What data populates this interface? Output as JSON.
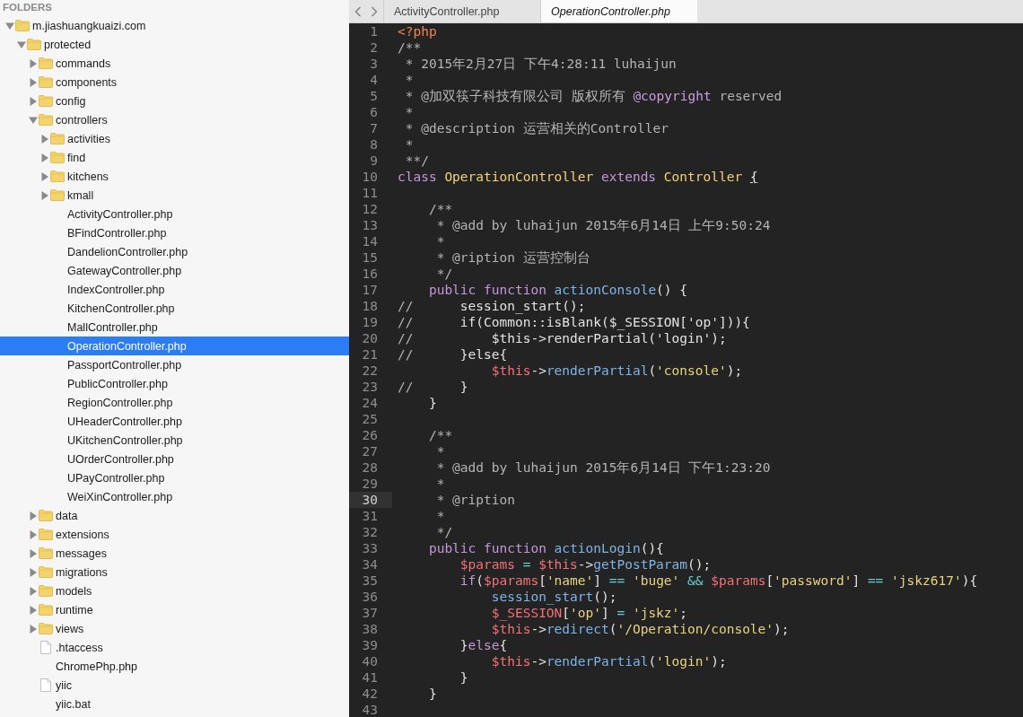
{
  "sidebar": {
    "header": "FOLDERS",
    "tree": [
      {
        "label": "m.jiashuangkuaizi.com",
        "kind": "folder",
        "expanded": true,
        "selected": false,
        "children": [
          {
            "label": "protected",
            "kind": "folder",
            "expanded": true,
            "selected": false,
            "children": [
              {
                "label": "commands",
                "kind": "folder",
                "expanded": false,
                "selected": false
              },
              {
                "label": "components",
                "kind": "folder",
                "expanded": false,
                "selected": false
              },
              {
                "label": "config",
                "kind": "folder",
                "expanded": false,
                "selected": false
              },
              {
                "label": "controllers",
                "kind": "folder",
                "expanded": true,
                "selected": false,
                "children": [
                  {
                    "label": "activities",
                    "kind": "folder",
                    "expanded": false,
                    "selected": false
                  },
                  {
                    "label": "find",
                    "kind": "folder",
                    "expanded": false,
                    "selected": false
                  },
                  {
                    "label": "kitchens",
                    "kind": "folder",
                    "expanded": false,
                    "selected": false
                  },
                  {
                    "label": "kmall",
                    "kind": "folder",
                    "expanded": false,
                    "selected": false
                  },
                  {
                    "label": "ActivityController.php",
                    "kind": "file",
                    "selected": false
                  },
                  {
                    "label": "BFindController.php",
                    "kind": "file",
                    "selected": false
                  },
                  {
                    "label": "DandelionController.php",
                    "kind": "file",
                    "selected": false
                  },
                  {
                    "label": "GatewayController.php",
                    "kind": "file",
                    "selected": false
                  },
                  {
                    "label": "IndexController.php",
                    "kind": "file",
                    "selected": false
                  },
                  {
                    "label": "KitchenController.php",
                    "kind": "file",
                    "selected": false
                  },
                  {
                    "label": "MallController.php",
                    "kind": "file",
                    "selected": false
                  },
                  {
                    "label": "OperationController.php",
                    "kind": "file",
                    "selected": true
                  },
                  {
                    "label": "PassportController.php",
                    "kind": "file",
                    "selected": false
                  },
                  {
                    "label": "PublicController.php",
                    "kind": "file",
                    "selected": false
                  },
                  {
                    "label": "RegionController.php",
                    "kind": "file",
                    "selected": false
                  },
                  {
                    "label": "UHeaderController.php",
                    "kind": "file",
                    "selected": false
                  },
                  {
                    "label": "UKitchenController.php",
                    "kind": "file",
                    "selected": false
                  },
                  {
                    "label": "UOrderController.php",
                    "kind": "file",
                    "selected": false
                  },
                  {
                    "label": "UPayController.php",
                    "kind": "file",
                    "selected": false
                  },
                  {
                    "label": "WeiXinController.php",
                    "kind": "file",
                    "selected": false
                  }
                ]
              },
              {
                "label": "data",
                "kind": "folder",
                "expanded": false,
                "selected": false
              },
              {
                "label": "extensions",
                "kind": "folder",
                "expanded": false,
                "selected": false
              },
              {
                "label": "messages",
                "kind": "folder",
                "expanded": false,
                "selected": false
              },
              {
                "label": "migrations",
                "kind": "folder",
                "expanded": false,
                "selected": false
              },
              {
                "label": "models",
                "kind": "folder",
                "expanded": false,
                "selected": false
              },
              {
                "label": "runtime",
                "kind": "folder",
                "expanded": false,
                "selected": false
              },
              {
                "label": "views",
                "kind": "folder",
                "expanded": false,
                "selected": false
              },
              {
                "label": ".htaccess",
                "kind": "page",
                "selected": false
              },
              {
                "label": "ChromePhp.php",
                "kind": "file",
                "selected": false
              },
              {
                "label": "yiic",
                "kind": "page",
                "selected": false
              },
              {
                "label": "yiic.bat",
                "kind": "file",
                "selected": false
              }
            ]
          }
        ]
      }
    ]
  },
  "tabs": [
    {
      "label": "ActivityController.php",
      "selected": false
    },
    {
      "label": "OperationController.php",
      "selected": true
    }
  ],
  "editor": {
    "lines": [
      {
        "number": "1",
        "current": false,
        "tokens": [
          {
            "text": "<?php",
            "kind": "tag"
          }
        ]
      },
      {
        "number": "2",
        "current": false,
        "tokens": [
          {
            "text": "/**",
            "kind": "comment"
          }
        ]
      },
      {
        "number": "3",
        "current": false,
        "tokens": [
          {
            "text": " * 2015年2月27日 下午4:28:11 luhaijun",
            "kind": "comment"
          }
        ]
      },
      {
        "number": "4",
        "current": false,
        "tokens": [
          {
            "text": " *",
            "kind": "comment"
          }
        ]
      },
      {
        "number": "5",
        "current": false,
        "tokens": [
          {
            "text": " * @加双筷子科技有限公司 版权所有 ",
            "kind": "comment"
          },
          {
            "text": "@copyright",
            "kind": "doctag"
          },
          {
            "text": " reserved",
            "kind": "comment"
          }
        ]
      },
      {
        "number": "6",
        "current": false,
        "tokens": [
          {
            "text": " *",
            "kind": "comment"
          }
        ]
      },
      {
        "number": "7",
        "current": false,
        "tokens": [
          {
            "text": " * @description 运营相关的Controller",
            "kind": "comment"
          }
        ]
      },
      {
        "number": "8",
        "current": false,
        "tokens": [
          {
            "text": " *",
            "kind": "comment"
          }
        ]
      },
      {
        "number": "9",
        "current": false,
        "tokens": [
          {
            "text": " **/",
            "kind": "comment"
          }
        ]
      },
      {
        "number": "10",
        "current": false,
        "tokens": [
          {
            "text": "class",
            "kind": "keyword"
          },
          {
            "text": " OperationController",
            "kind": "class"
          },
          {
            "text": " extends",
            "kind": "keyword"
          },
          {
            "text": " Controller ",
            "kind": "class"
          },
          {
            "text": "{",
            "kind": "match"
          }
        ]
      },
      {
        "number": "11",
        "current": false
      },
      {
        "number": "12",
        "current": false,
        "tokens": [
          {
            "text": "    /**",
            "kind": "comment"
          }
        ]
      },
      {
        "number": "13",
        "current": false,
        "tokens": [
          {
            "text": "     * @add by luhaijun 2015年6月14日 上午9:50:24",
            "kind": "comment"
          }
        ]
      },
      {
        "number": "14",
        "current": false,
        "tokens": [
          {
            "text": "     *",
            "kind": "comment"
          }
        ]
      },
      {
        "number": "15",
        "current": false,
        "tokens": [
          {
            "text": "     * @ription 运营控制台",
            "kind": "comment"
          }
        ]
      },
      {
        "number": "16",
        "current": false,
        "tokens": [
          {
            "text": "     */",
            "kind": "comment"
          }
        ]
      },
      {
        "number": "17",
        "current": false,
        "tokens": [
          {
            "text": "    public",
            "kind": "keyword"
          },
          {
            "text": " function",
            "kind": "keyword"
          },
          {
            "text": " actionConsole",
            "kind": "function"
          },
          {
            "text": "() {",
            "kind": "plain"
          }
        ]
      },
      {
        "number": "18",
        "current": false,
        "tokens": [
          {
            "text": "//",
            "kind": "comment"
          },
          {
            "text": "      session_start();",
            "kind": "plain"
          }
        ]
      },
      {
        "number": "19",
        "current": false,
        "tokens": [
          {
            "text": "//",
            "kind": "comment"
          },
          {
            "text": "      if(Common::isBlank($_SESSION['op'])){",
            "kind": "plain"
          }
        ]
      },
      {
        "number": "20",
        "current": false,
        "tokens": [
          {
            "text": "//",
            "kind": "comment"
          },
          {
            "text": "          $this->renderPartial('login');",
            "kind": "plain"
          }
        ]
      },
      {
        "number": "21",
        "current": false,
        "tokens": [
          {
            "text": "//",
            "kind": "comment"
          },
          {
            "text": "      }else{",
            "kind": "plain"
          }
        ]
      },
      {
        "number": "22",
        "current": false,
        "tokens": [
          {
            "text": "            $this",
            "kind": "variable"
          },
          {
            "text": "->",
            "kind": "plain"
          },
          {
            "text": "renderPartial",
            "kind": "function"
          },
          {
            "text": "(",
            "kind": "plain"
          },
          {
            "text": "'console'",
            "kind": "string"
          },
          {
            "text": ");",
            "kind": "plain"
          }
        ]
      },
      {
        "number": "23",
        "current": false,
        "tokens": [
          {
            "text": "//",
            "kind": "comment"
          },
          {
            "text": "      }",
            "kind": "plain"
          }
        ]
      },
      {
        "number": "24",
        "current": false,
        "tokens": [
          {
            "text": "    }",
            "kind": "plain"
          }
        ]
      },
      {
        "number": "25",
        "current": false
      },
      {
        "number": "26",
        "current": false,
        "tokens": [
          {
            "text": "    /**",
            "kind": "comment"
          }
        ]
      },
      {
        "number": "27",
        "current": false,
        "tokens": [
          {
            "text": "     *",
            "kind": "comment"
          }
        ]
      },
      {
        "number": "28",
        "current": false,
        "tokens": [
          {
            "text": "     * @add by luhaijun 2015年6月14日 下午1:23:20",
            "kind": "comment"
          }
        ]
      },
      {
        "number": "29",
        "current": false,
        "tokens": [
          {
            "text": "     *",
            "kind": "comment"
          }
        ]
      },
      {
        "number": "30",
        "current": true,
        "tokens": [
          {
            "text": "     * @ription",
            "kind": "comment"
          }
        ]
      },
      {
        "number": "31",
        "current": false,
        "tokens": [
          {
            "text": "     *",
            "kind": "comment"
          }
        ]
      },
      {
        "number": "32",
        "current": false,
        "tokens": [
          {
            "text": "     */",
            "kind": "comment"
          }
        ]
      },
      {
        "number": "33",
        "current": false,
        "tokens": [
          {
            "text": "    public",
            "kind": "keyword"
          },
          {
            "text": " function",
            "kind": "keyword"
          },
          {
            "text": " actionLogin",
            "kind": "function"
          },
          {
            "text": "(){",
            "kind": "plain"
          }
        ]
      },
      {
        "number": "34",
        "current": false,
        "tokens": [
          {
            "text": "        $params",
            "kind": "variable"
          },
          {
            "text": " =",
            "kind": "operator"
          },
          {
            "text": " $this",
            "kind": "variable"
          },
          {
            "text": "->",
            "kind": "plain"
          },
          {
            "text": "getPostParam",
            "kind": "function"
          },
          {
            "text": "();",
            "kind": "plain"
          }
        ]
      },
      {
        "number": "35",
        "current": false,
        "tokens": [
          {
            "text": "        if",
            "kind": "keyword"
          },
          {
            "text": "(",
            "kind": "plain"
          },
          {
            "text": "$params",
            "kind": "variable"
          },
          {
            "text": "[",
            "kind": "plain"
          },
          {
            "text": "'name'",
            "kind": "string"
          },
          {
            "text": "] ",
            "kind": "plain"
          },
          {
            "text": "==",
            "kind": "operator"
          },
          {
            "text": " 'buge'",
            "kind": "string"
          },
          {
            "text": " &&",
            "kind": "operator"
          },
          {
            "text": " $params",
            "kind": "variable"
          },
          {
            "text": "[",
            "kind": "plain"
          },
          {
            "text": "'password'",
            "kind": "string"
          },
          {
            "text": "] ",
            "kind": "plain"
          },
          {
            "text": "==",
            "kind": "operator"
          },
          {
            "text": " 'jskz617'",
            "kind": "string"
          },
          {
            "text": "){",
            "kind": "plain"
          }
        ]
      },
      {
        "number": "36",
        "current": false,
        "tokens": [
          {
            "text": "            session_start",
            "kind": "function"
          },
          {
            "text": "();",
            "kind": "plain"
          }
        ]
      },
      {
        "number": "37",
        "current": false,
        "tokens": [
          {
            "text": "            $_SESSION",
            "kind": "variable"
          },
          {
            "text": "[",
            "kind": "plain"
          },
          {
            "text": "'op'",
            "kind": "string"
          },
          {
            "text": "] ",
            "kind": "plain"
          },
          {
            "text": "=",
            "kind": "operator"
          },
          {
            "text": " 'jskz'",
            "kind": "string"
          },
          {
            "text": ";",
            "kind": "plain"
          }
        ]
      },
      {
        "number": "38",
        "current": false,
        "tokens": [
          {
            "text": "            $this",
            "kind": "variable"
          },
          {
            "text": "->",
            "kind": "plain"
          },
          {
            "text": "redirect",
            "kind": "function"
          },
          {
            "text": "(",
            "kind": "plain"
          },
          {
            "text": "'/Operation/console'",
            "kind": "string"
          },
          {
            "text": ");",
            "kind": "plain"
          }
        ]
      },
      {
        "number": "39",
        "current": false,
        "tokens": [
          {
            "text": "        }",
            "kind": "plain"
          },
          {
            "text": "else",
            "kind": "keyword"
          },
          {
            "text": "{",
            "kind": "plain"
          }
        ]
      },
      {
        "number": "40",
        "current": false,
        "tokens": [
          {
            "text": "            $this",
            "kind": "variable"
          },
          {
            "text": "->",
            "kind": "plain"
          },
          {
            "text": "renderPartial",
            "kind": "function"
          },
          {
            "text": "(",
            "kind": "plain"
          },
          {
            "text": "'login'",
            "kind": "string"
          },
          {
            "text": ");",
            "kind": "plain"
          }
        ]
      },
      {
        "number": "41",
        "current": false,
        "tokens": [
          {
            "text": "        }",
            "kind": "plain"
          }
        ]
      },
      {
        "number": "42",
        "current": false,
        "tokens": [
          {
            "text": "    }",
            "kind": "plain"
          }
        ]
      },
      {
        "number": "43",
        "current": false
      }
    ]
  }
}
